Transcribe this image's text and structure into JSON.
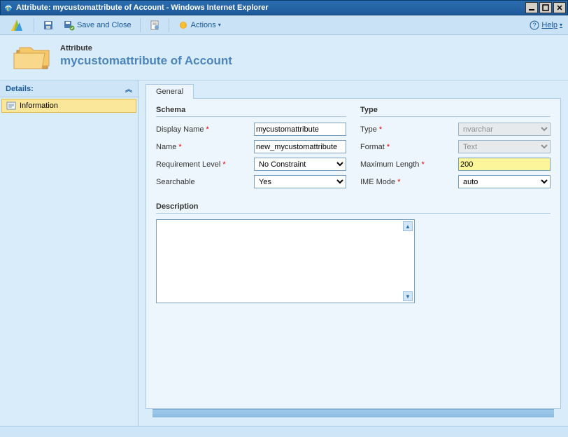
{
  "window": {
    "title": "Attribute: mycustomattribute of Account - Windows Internet Explorer"
  },
  "toolbar": {
    "save_close": "Save and Close",
    "actions": "Actions",
    "help": "Help"
  },
  "header": {
    "kicker": "Attribute",
    "title": "mycustomattribute of Account"
  },
  "sidebar": {
    "section": "Details:",
    "items": [
      {
        "label": "Information"
      }
    ]
  },
  "tabs": [
    {
      "label": "General"
    }
  ],
  "form": {
    "schema": {
      "title": "Schema",
      "display_name": {
        "label": "Display Name",
        "value": "mycustomattribute",
        "required": true
      },
      "name": {
        "label": "Name",
        "value": "new_mycustomattribute",
        "required": true
      },
      "requirement_level": {
        "label": "Requirement Level",
        "value": "No Constraint",
        "required": true
      },
      "searchable": {
        "label": "Searchable",
        "value": "Yes",
        "required": false
      }
    },
    "type": {
      "title": "Type",
      "type_field": {
        "label": "Type",
        "value": "nvarchar",
        "required": true,
        "disabled": true
      },
      "format": {
        "label": "Format",
        "value": "Text",
        "required": true,
        "disabled": true
      },
      "max_length": {
        "label": "Maximum Length",
        "value": "200",
        "required": true,
        "highlight": true
      },
      "ime_mode": {
        "label": "IME Mode",
        "value": "auto",
        "required": true
      }
    },
    "description": {
      "title": "Description",
      "value": ""
    }
  }
}
